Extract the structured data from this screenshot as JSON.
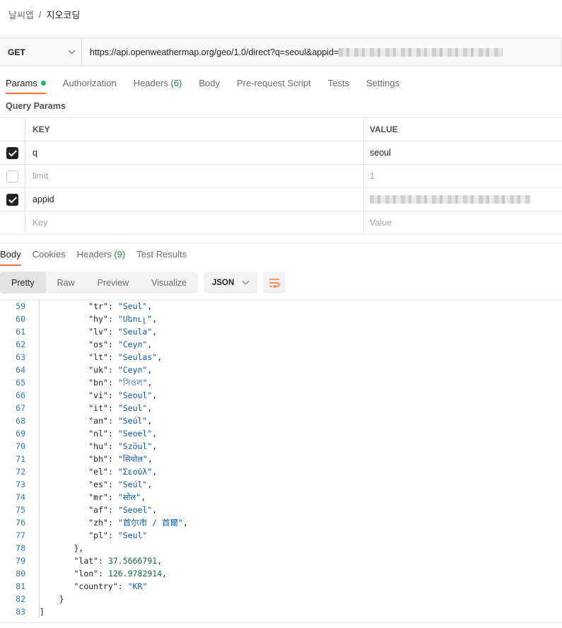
{
  "breadcrumb": {
    "parent": "날씨앱",
    "separator": "/",
    "current": "지오코딩"
  },
  "request": {
    "method": "GET",
    "url_visible": "https://api.openweathermap.org/geo/1.0/direct?q=seoul&appid="
  },
  "request_tabs": [
    {
      "label": "Params",
      "active": true,
      "has_dot": true
    },
    {
      "label": "Authorization"
    },
    {
      "label": "Headers",
      "count": "(6)"
    },
    {
      "label": "Body"
    },
    {
      "label": "Pre-request Script"
    },
    {
      "label": "Tests"
    },
    {
      "label": "Settings"
    }
  ],
  "query_params": {
    "title": "Query Params",
    "columns": {
      "key": "KEY",
      "value": "VALUE"
    },
    "rows": [
      {
        "checked": true,
        "key": "q",
        "value": "seoul"
      },
      {
        "checked": false,
        "key": "limit",
        "value": "1"
      },
      {
        "checked": true,
        "key": "appid",
        "value": ""
      }
    ],
    "placeholder": {
      "key": "Key",
      "value": "Value"
    }
  },
  "response_tabs": [
    {
      "label": "Body",
      "active": true
    },
    {
      "label": "Cookies"
    },
    {
      "label": "Headers",
      "count": "(9)"
    },
    {
      "label": "Test Results"
    }
  ],
  "view_modes": [
    "Pretty",
    "Raw",
    "Preview",
    "Visualize"
  ],
  "active_view": "Pretty",
  "format": "JSON",
  "icons": {
    "dropdown": "chevron-down-icon",
    "wrap": "wrap-lines-icon",
    "checkbox": "check-icon"
  },
  "colors": {
    "accent": "#ff6c37",
    "success": "#1fb36a",
    "string": "#0a5aa6",
    "number": "#116644",
    "line_number": "#3d7a99"
  },
  "code_lines": [
    {
      "n": "59",
      "indent": 3,
      "key": "tr",
      "str": "Seul",
      "comma": true
    },
    {
      "n": "60",
      "indent": 3,
      "key": "hy",
      "str": "Սեուլ",
      "comma": true
    },
    {
      "n": "61",
      "indent": 3,
      "key": "lv",
      "str": "Seula",
      "comma": true
    },
    {
      "n": "62",
      "indent": 3,
      "key": "os",
      "str": "Сеул",
      "comma": true
    },
    {
      "n": "63",
      "indent": 3,
      "key": "lt",
      "str": "Seulas",
      "comma": true
    },
    {
      "n": "64",
      "indent": 3,
      "key": "uk",
      "str": "Сеул",
      "comma": true
    },
    {
      "n": "65",
      "indent": 3,
      "key": "bn",
      "str": "সিওল",
      "comma": true
    },
    {
      "n": "66",
      "indent": 3,
      "key": "vi",
      "str": "Seoul",
      "comma": true
    },
    {
      "n": "67",
      "indent": 3,
      "key": "it",
      "str": "Seul",
      "comma": true
    },
    {
      "n": "68",
      "indent": 3,
      "key": "an",
      "str": "Seúl",
      "comma": true
    },
    {
      "n": "69",
      "indent": 3,
      "key": "nl",
      "str": "Seoel",
      "comma": true
    },
    {
      "n": "70",
      "indent": 3,
      "key": "hu",
      "str": "Szöul",
      "comma": true
    },
    {
      "n": "71",
      "indent": 3,
      "key": "bh",
      "str": "सियोल",
      "comma": true
    },
    {
      "n": "72",
      "indent": 3,
      "key": "el",
      "str": "Σεούλ",
      "comma": true
    },
    {
      "n": "73",
      "indent": 3,
      "key": "es",
      "str": "Seúl",
      "comma": true
    },
    {
      "n": "74",
      "indent": 3,
      "key": "mr",
      "str": "सोल",
      "comma": true
    },
    {
      "n": "75",
      "indent": 3,
      "key": "af",
      "str": "Seoel",
      "comma": true
    },
    {
      "n": "76",
      "indent": 3,
      "key": "zh",
      "str": "首尔市 / 首爾",
      "comma": true
    },
    {
      "n": "77",
      "indent": 3,
      "key": "pl",
      "str": "Seul",
      "comma": false
    },
    {
      "n": "78",
      "indent": 2,
      "punct": "},",
      "comma": false
    },
    {
      "n": "79",
      "indent": 2,
      "key": "lat",
      "num": "37.5666791",
      "comma": true
    },
    {
      "n": "80",
      "indent": 2,
      "key": "lon",
      "num": "126.9782914",
      "comma": true
    },
    {
      "n": "81",
      "indent": 2,
      "key": "country",
      "str": "KR",
      "comma": false
    },
    {
      "n": "82",
      "indent": 1,
      "punct": "}",
      "comma": false
    },
    {
      "n": "83",
      "indent": 0,
      "punct": "]",
      "comma": false
    }
  ]
}
